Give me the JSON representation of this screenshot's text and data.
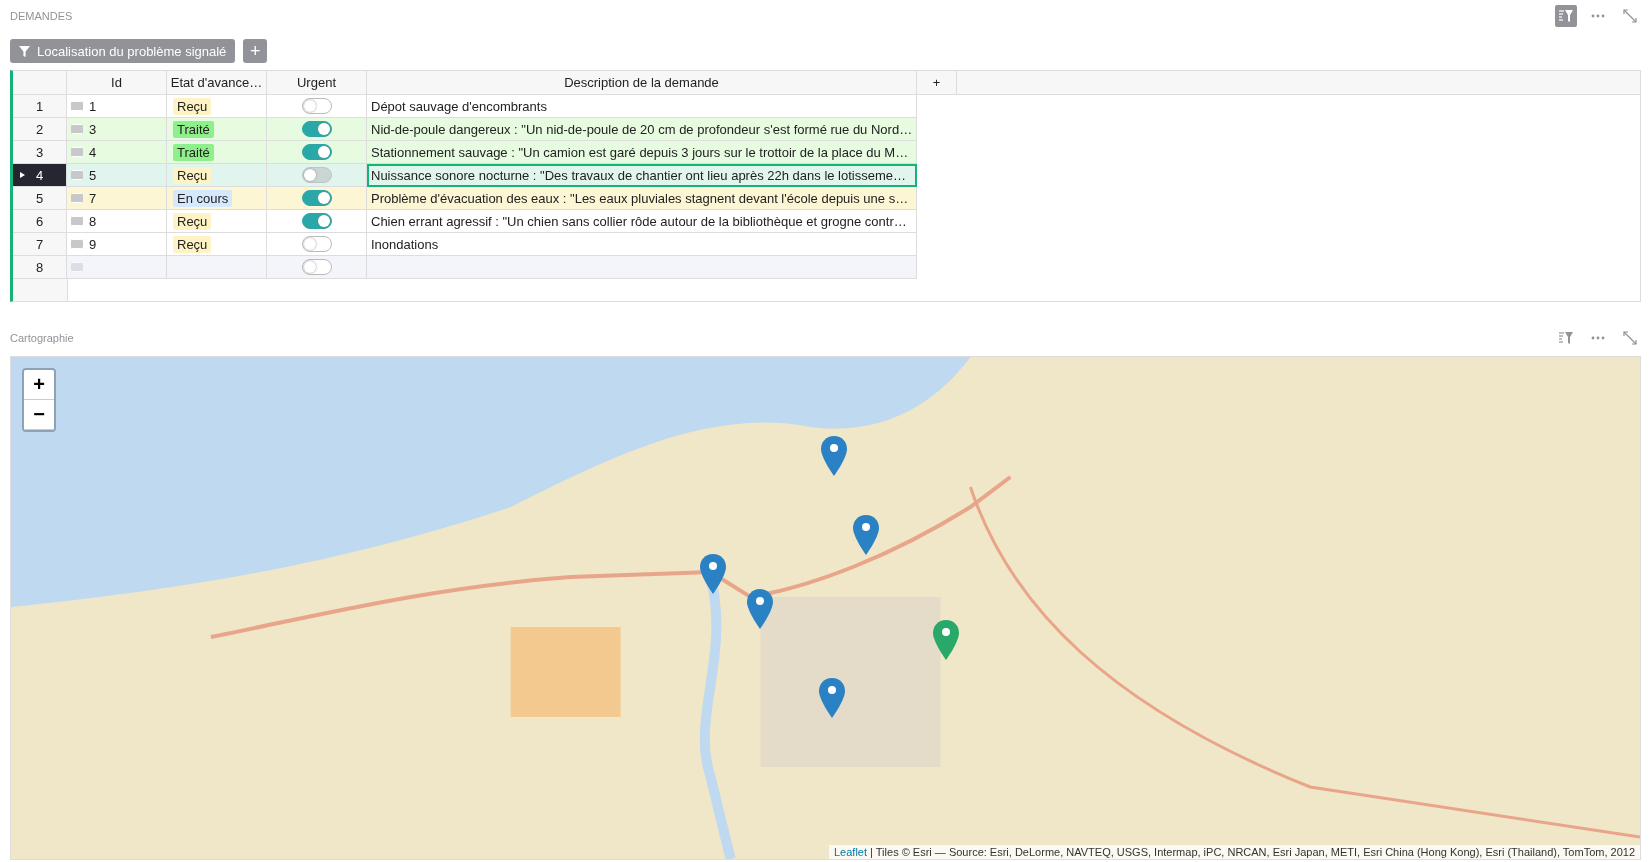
{
  "table_section": {
    "title": "DEMANDES",
    "filter_active": true,
    "filter_button": "Localisation du problème signalé",
    "add_filter": "+",
    "columns": [
      "Id",
      "Etat d'avance…",
      "Urgent",
      "Description de la demande",
      "+"
    ],
    "rows": [
      {
        "num": "1",
        "id": "1",
        "status": {
          "label": "Reçu",
          "color": "#fdf3c4"
        },
        "urgent": false,
        "description": "Dépot sauvage d'encombrants",
        "color": "#ffffff",
        "selected": false,
        "kind": "record"
      },
      {
        "num": "2",
        "id": "3",
        "status": {
          "label": "Traité",
          "color": "#8ef08a"
        },
        "urgent": true,
        "description": "Nid-de-poule dangereux : \"Un nid-de-poule de 20 cm de profondeur s'est formé rue du Nord…",
        "color": "#e6fbe0",
        "selected": false,
        "kind": "record"
      },
      {
        "num": "3",
        "id": "4",
        "status": {
          "label": "Traité",
          "color": "#8ef08a"
        },
        "urgent": true,
        "description": "Stationnement sauvage : \"Un camion est garé depuis 3 jours sur le trottoir de la place du M…",
        "color": "#e6fbe0",
        "selected": false,
        "kind": "record"
      },
      {
        "num": "4",
        "id": "5",
        "status": {
          "label": "Reçu",
          "color": "#fdf3c4"
        },
        "urgent": false,
        "description": "Nuissance sonore nocturne : \"Des travaux de chantier ont lieu après 22h dans le lotisseme…",
        "color": "#ffffff",
        "selected": true,
        "kind": "record"
      },
      {
        "num": "5",
        "id": "7",
        "status": {
          "label": "En cours",
          "color": "#d6e8fb"
        },
        "urgent": true,
        "description": "Problème d'évacuation des eaux : \"Les eaux pluviales stagnent devant l'école depuis une s…",
        "color": "#fdf6d4",
        "selected": false,
        "kind": "record"
      },
      {
        "num": "6",
        "id": "8",
        "status": {
          "label": "Reçu",
          "color": "#fdf3c4"
        },
        "urgent": true,
        "description": "Chien errant agressif : \"Un chien sans collier rôde autour de la bibliothèque et grogne contr…",
        "color": "#ffffff",
        "selected": false,
        "kind": "record"
      },
      {
        "num": "7",
        "id": "9",
        "status": {
          "label": "Reçu",
          "color": "#fdf3c4"
        },
        "urgent": false,
        "description": "Inondations",
        "color": "#ffffff",
        "selected": false,
        "kind": "record"
      },
      {
        "num": "8",
        "urgent": false,
        "color": "#f4f5fa",
        "selected": false,
        "kind": "new"
      }
    ]
  },
  "map_section": {
    "title": "Cartographie",
    "filter_active": false,
    "zoom_in": "+",
    "zoom_out": "−",
    "markers": [
      {
        "selected": false
      },
      {
        "selected": false
      },
      {
        "selected": false
      },
      {
        "selected": false
      },
      {
        "selected": true
      },
      {
        "selected": false
      }
    ],
    "attribution_link": "Leaflet",
    "attribution": "| Tiles © Esri — Source: Esri, DeLorme, NAVTEQ, USGS, Intermap, iPC, NRCAN, Esri Japan, METI, Esri China (Hong Kong), Esri (Thailand), TomTom, 2012"
  }
}
